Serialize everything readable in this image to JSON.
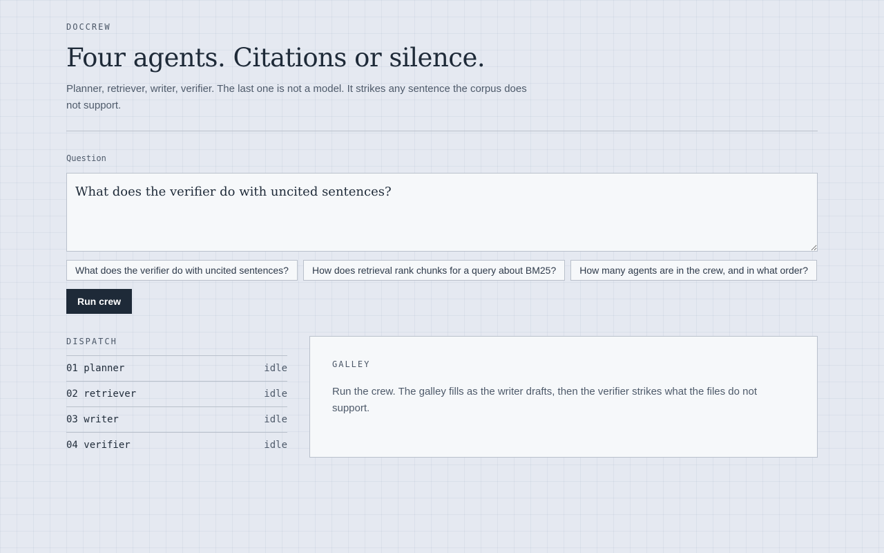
{
  "header": {
    "brand": "DOCCREW",
    "headline": "Four agents. Citations or silence.",
    "lede": "Planner, retriever, writer, verifier. The last one is not a model. It strikes any sentence the corpus does not support."
  },
  "question": {
    "label": "Question",
    "value": "What does the verifier do with uncited sentences?"
  },
  "suggestions": [
    "What does the verifier do with uncited sentences?",
    "How does retrieval rank chunks for a query about BM25?",
    "How many agents are in the crew, and in what order?"
  ],
  "run_button": "Run crew",
  "dispatch": {
    "title": "DISPATCH",
    "agents": [
      {
        "label": "01 planner",
        "status": "idle"
      },
      {
        "label": "02 retriever",
        "status": "idle"
      },
      {
        "label": "03 writer",
        "status": "idle"
      },
      {
        "label": "04 verifier",
        "status": "idle"
      }
    ]
  },
  "galley": {
    "title": "GALLEY",
    "body": "Run the crew. The galley fills as the writer drafts, then the verifier strikes what the files do not support."
  },
  "colors": {
    "background": "#e5e9f1",
    "ink": "#1e2a38",
    "panel": "#f6f8fa",
    "border": "#b9c0cb"
  }
}
